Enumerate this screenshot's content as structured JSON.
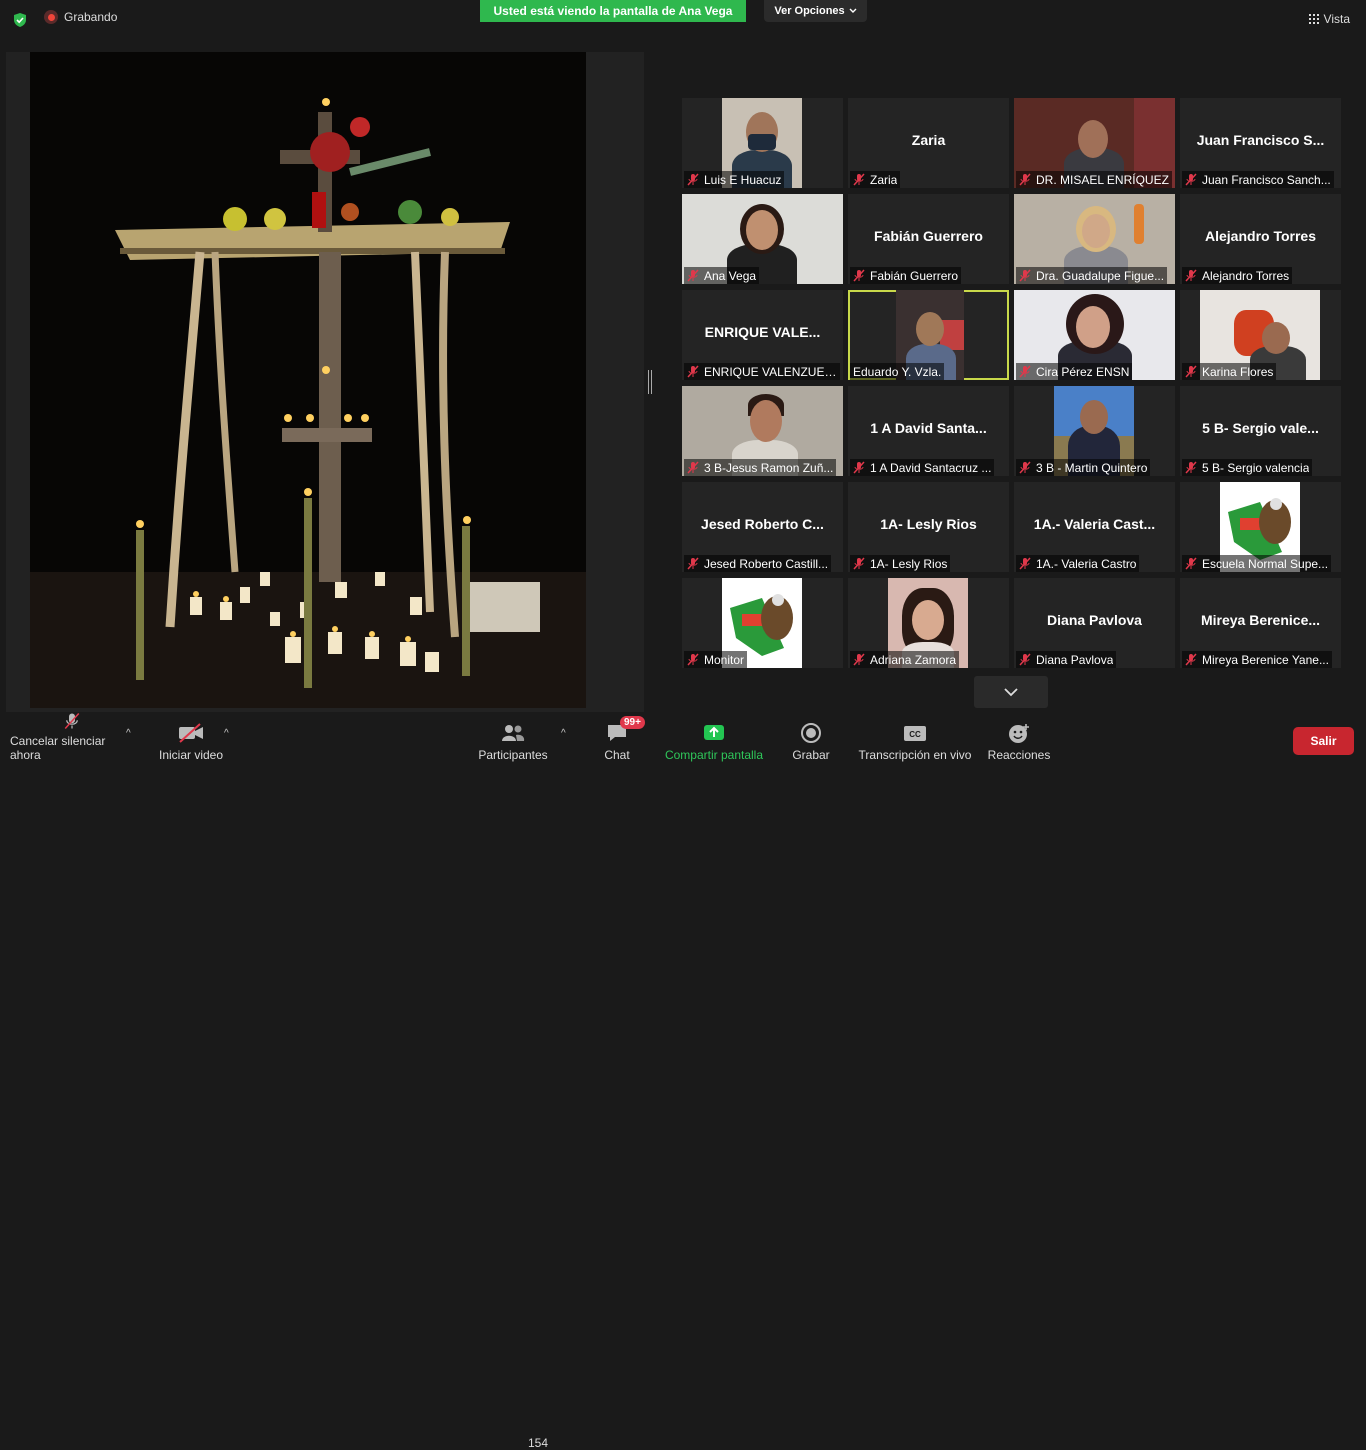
{
  "topbar": {
    "recording_label": "Grabando",
    "share_banner": "Usted está viendo la pantalla de Ana Vega",
    "view_options": "Ver Opciones",
    "view_button": "Vista"
  },
  "participants": [
    {
      "name": "Luis E Huacuz",
      "video": true,
      "muted": true
    },
    {
      "name": "Zaria",
      "display": "Zaria",
      "video": false,
      "muted": true
    },
    {
      "name": "DR. MISAEL ENRÍQUEZ",
      "video": true,
      "muted": true
    },
    {
      "name": "Juan Francisco Sanch...",
      "display": "Juan Francisco S...",
      "video": false,
      "muted": true
    },
    {
      "name": "Ana Vega",
      "video": true,
      "muted": true
    },
    {
      "name": "Fabián Guerrero",
      "display": "Fabián Guerrero",
      "video": false,
      "muted": true
    },
    {
      "name": "Dra. Guadalupe Figue...",
      "video": true,
      "muted": true
    },
    {
      "name": "Alejandro Torres",
      "display": "Alejandro Torres",
      "video": false,
      "muted": true
    },
    {
      "name": "ENRIQUE VALENZUEL...",
      "display": "ENRIQUE VALE...",
      "video": false,
      "muted": true
    },
    {
      "name": "Eduardo Y. Vzla.",
      "video": true,
      "muted": false,
      "active": true
    },
    {
      "name": "Cira Pérez ENSN",
      "video": true,
      "muted": true
    },
    {
      "name": "Karina Flores",
      "video": true,
      "muted": true
    },
    {
      "name": "3 B-Jesus Ramon Zuñ...",
      "video": true,
      "muted": true
    },
    {
      "name": "1 A David Santacruz ...",
      "display": "1 A David Santa...",
      "video": false,
      "muted": true
    },
    {
      "name": "3 B - Martin Quintero",
      "video": true,
      "muted": true
    },
    {
      "name": "5 B- Sergio valencia",
      "display": "5 B- Sergio vale...",
      "video": false,
      "muted": true
    },
    {
      "name": "Jesed Roberto Castill...",
      "display": "Jesed Roberto C...",
      "video": false,
      "muted": true
    },
    {
      "name": "1A- Lesly Rios",
      "display": "1A- Lesly Rios",
      "video": false,
      "muted": true
    },
    {
      "name": "1A.- Valeria Castro",
      "display": "1A.- Valeria Cast...",
      "video": false,
      "muted": true
    },
    {
      "name": "Escuela Normal Supe...",
      "video": true,
      "muted": true
    },
    {
      "name": "Monitor",
      "video": true,
      "muted": true
    },
    {
      "name": "Adriana Zamora",
      "video": true,
      "muted": true
    },
    {
      "name": "Diana Pavlova",
      "display": "Diana Pavlova",
      "video": false,
      "muted": true
    },
    {
      "name": "Mireya Berenice Yane...",
      "display": "Mireya  Berenice...",
      "video": false,
      "muted": true
    }
  ],
  "toolbar": {
    "mute_label": "Cancelar silenciar ahora",
    "video_label": "Iniciar video",
    "participants_label": "Participantes",
    "participants_count": "154",
    "chat_label": "Chat",
    "chat_badge": "99+",
    "share_label": "Compartir pantalla",
    "record_label": "Grabar",
    "transcript_label": "Transcripción en vivo",
    "reactions_label": "Reacciones",
    "leave_label": "Salir"
  },
  "colors": {
    "share_green": "#2fb84e",
    "leave_red": "#c8262f",
    "active_speaker": "#c8d94a",
    "badge_red": "#e0384b"
  }
}
